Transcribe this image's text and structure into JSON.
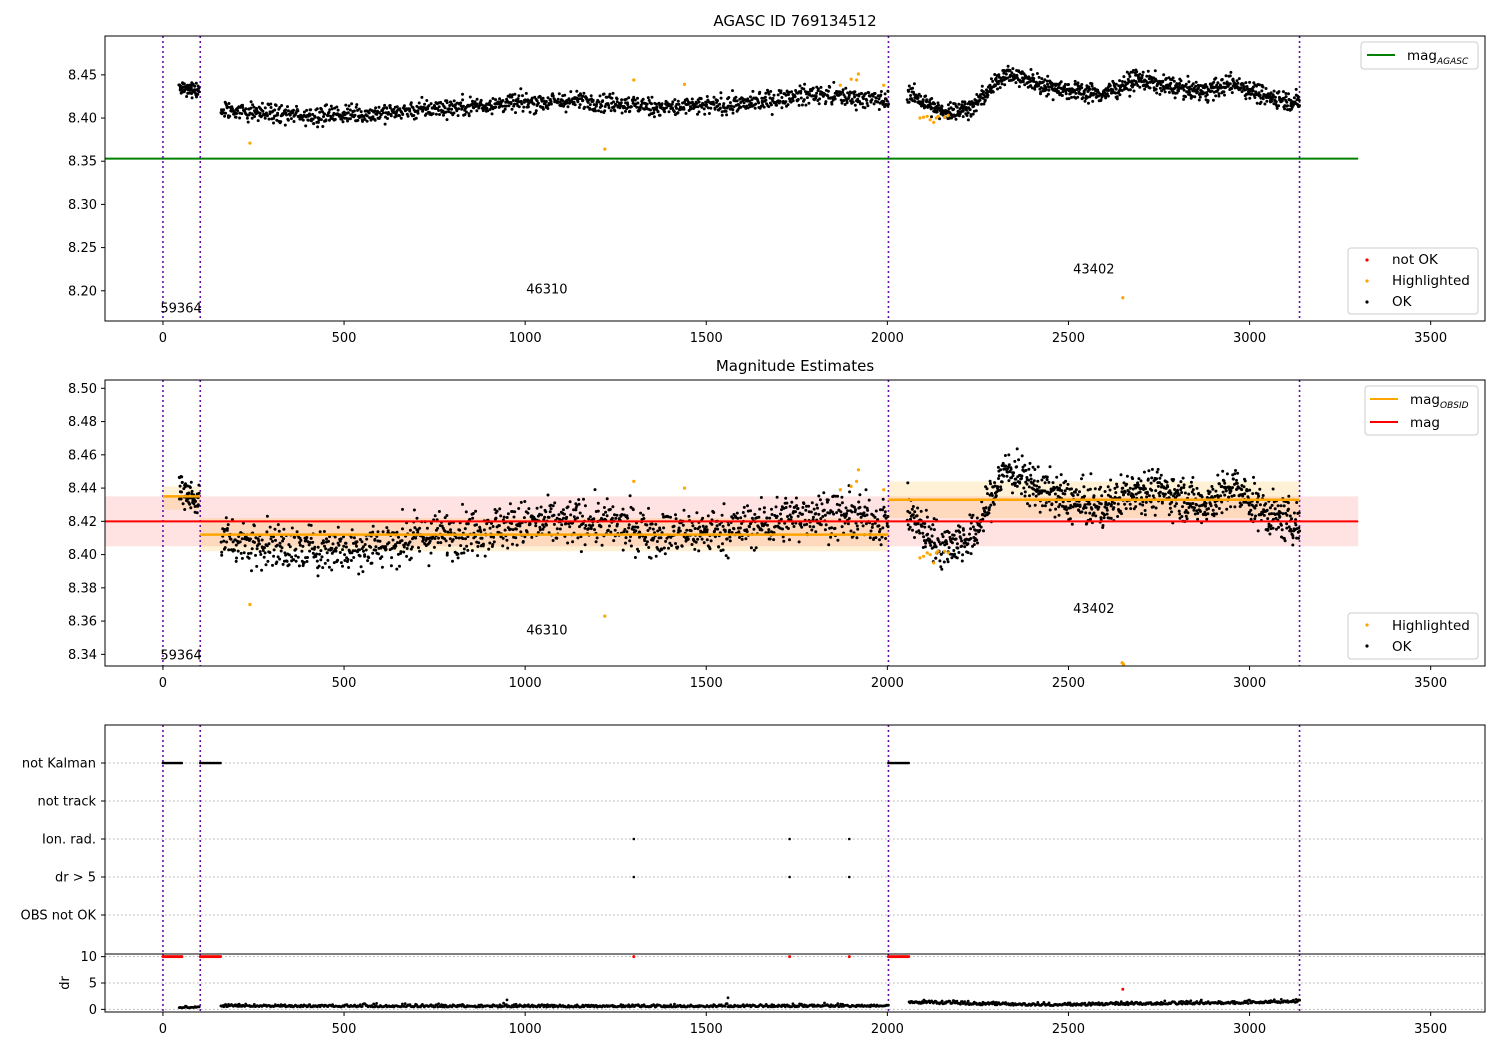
{
  "chart_data": [
    {
      "type": "scatter",
      "title": "AGASC ID 769134512",
      "xlim": [
        -160,
        3650
      ],
      "ylim": [
        8.165,
        8.495
      ],
      "x_ticks": [
        0,
        500,
        1000,
        1500,
        2000,
        2500,
        3000,
        3500
      ],
      "y_ticks": [
        8.2,
        8.25,
        8.3,
        8.35,
        8.4,
        8.45
      ],
      "grid": false,
      "legend_upper": {
        "placement": "top-right",
        "entries": [
          {
            "label": "mag",
            "sub": "AGASC",
            "color": "#008000"
          }
        ]
      },
      "legend_lower": {
        "placement": "bottom-right",
        "entries": [
          {
            "label": "not OK",
            "color": "#ff0000"
          },
          {
            "label": "Highlighted",
            "color": "#ffa500"
          },
          {
            "label": "OK",
            "color": "#000000"
          }
        ]
      },
      "reference_line": {
        "name": "mag_AGASC",
        "y": 8.353,
        "x": [
          -160,
          3300
        ],
        "color": "#008000"
      },
      "obsid_boundaries": [
        0,
        103,
        2003,
        3138
      ],
      "obsid_labels": [
        {
          "text": "59364",
          "x": 50,
          "y": 8.175
        },
        {
          "text": "46310",
          "x": 1060,
          "y": 8.197
        },
        {
          "text": "43402",
          "x": 2570,
          "y": 8.22
        }
      ],
      "series": [
        {
          "name": "OK",
          "color": "#000000",
          "segments": [
            {
              "x0": 45,
              "x1": 100,
              "n": 60,
              "level": [
                8.437,
                8.43
              ],
              "noise": 0.0045
            },
            {
              "x0": 160,
              "x1": 2003,
              "n": 1300,
              "level": [
                8.41,
                8.403,
                8.405,
                8.412,
                8.418,
                8.42,
                8.412,
                8.416,
                8.428,
                8.42
              ],
              "noise": 0.0055
            },
            {
              "x0": 2055,
              "x1": 3138,
              "n": 1000,
              "level": [
                8.43,
                8.407,
                8.412,
                8.452,
                8.44,
                8.432,
                8.428,
                8.445,
                8.437,
                8.43,
                8.44,
                8.425,
                8.418
              ],
              "noise": 0.0055
            }
          ]
        },
        {
          "name": "Highlighted",
          "color": "#ffa500",
          "points": [
            [
              240,
              8.371
            ],
            [
              1220,
              8.364
            ],
            [
              1300,
              8.444
            ],
            [
              1440,
              8.439
            ],
            [
              1870,
              8.438
            ],
            [
              1900,
              8.445
            ],
            [
              1915,
              8.444
            ],
            [
              1920,
              8.451
            ],
            [
              1990,
              8.438
            ],
            [
              2090,
              8.4
            ],
            [
              2100,
              8.401
            ],
            [
              2110,
              8.402
            ],
            [
              2118,
              8.398
            ],
            [
              2128,
              8.395
            ],
            [
              2135,
              8.4
            ],
            [
              2140,
              8.402
            ],
            [
              2158,
              8.401
            ],
            [
              2168,
              8.403
            ],
            [
              2650,
              8.192
            ]
          ]
        },
        {
          "name": "not OK",
          "color": "#ff0000",
          "points": []
        }
      ]
    },
    {
      "type": "scatter",
      "title": "Magnitude Estimates",
      "xlim": [
        -160,
        3650
      ],
      "ylim": [
        8.333,
        8.505
      ],
      "x_ticks": [
        0,
        500,
        1000,
        1500,
        2000,
        2500,
        3000,
        3500
      ],
      "y_ticks": [
        8.34,
        8.36,
        8.38,
        8.4,
        8.42,
        8.44,
        8.46,
        8.48,
        8.5
      ],
      "grid": false,
      "legend_upper": {
        "placement": "top-right",
        "entries": [
          {
            "label": "mag",
            "sub": "OBSID",
            "color": "#ffa500"
          },
          {
            "label": "mag",
            "sub": "",
            "color": "#ff0000"
          }
        ]
      },
      "legend_lower": {
        "placement": "bottom-right",
        "entries": [
          {
            "label": "Highlighted",
            "color": "#ffa500"
          },
          {
            "label": "OK",
            "color": "#000000"
          }
        ]
      },
      "mag": {
        "value": 8.42,
        "band": [
          8.405,
          8.435
        ],
        "x": [
          -160,
          3300
        ]
      },
      "mag_obsid": [
        {
          "x0": 0,
          "x1": 103,
          "y": 8.435,
          "band": [
            8.427,
            8.441
          ]
        },
        {
          "x0": 103,
          "x1": 2003,
          "y": 8.412,
          "band": [
            8.402,
            8.422
          ]
        },
        {
          "x0": 2003,
          "x1": 3138,
          "y": 8.433,
          "band": [
            8.422,
            8.444
          ]
        }
      ],
      "obsid_boundaries": [
        0,
        103,
        2003,
        3138
      ],
      "obsid_labels": [
        {
          "text": "59364",
          "x": 50,
          "y": 8.337
        },
        {
          "text": "46310",
          "x": 1060,
          "y": 8.352
        },
        {
          "text": "43402",
          "x": 2570,
          "y": 8.365
        }
      ],
      "series": [
        {
          "name": "OK",
          "color": "#000000",
          "segments": [
            {
              "x0": 45,
              "x1": 100,
              "n": 60,
              "level": [
                8.44,
                8.432
              ],
              "noise": 0.005
            },
            {
              "x0": 160,
              "x1": 2003,
              "n": 1300,
              "level": [
                8.41,
                8.403,
                8.405,
                8.412,
                8.418,
                8.42,
                8.412,
                8.416,
                8.425,
                8.42
              ],
              "noise": 0.007
            },
            {
              "x0": 2055,
              "x1": 3138,
              "n": 1000,
              "level": [
                8.425,
                8.405,
                8.41,
                8.452,
                8.44,
                8.432,
                8.428,
                8.44,
                8.437,
                8.43,
                8.44,
                8.425,
                8.418
              ],
              "noise": 0.0065
            }
          ]
        },
        {
          "name": "Highlighted",
          "color": "#ffa500",
          "points": [
            [
              240,
              8.37
            ],
            [
              1220,
              8.363
            ],
            [
              1300,
              8.444
            ],
            [
              1440,
              8.44
            ],
            [
              1870,
              8.439
            ],
            [
              1900,
              8.441
            ],
            [
              1915,
              8.444
            ],
            [
              1920,
              8.451
            ],
            [
              1990,
              8.439
            ],
            [
              2090,
              8.398
            ],
            [
              2100,
              8.399
            ],
            [
              2110,
              8.401
            ],
            [
              2118,
              8.4
            ],
            [
              2128,
              8.395
            ],
            [
              2135,
              8.401
            ],
            [
              2140,
              8.402
            ],
            [
              2158,
              8.402
            ],
            [
              2168,
              8.401
            ],
            [
              2648,
              8.335
            ],
            [
              2652,
              8.334
            ]
          ]
        }
      ]
    },
    {
      "type": "scatter",
      "title": "",
      "xlim": [
        -160,
        3650
      ],
      "categories": [
        "not Kalman",
        "not track",
        "Ion. rad.",
        "dr > 5",
        "OBS not OK"
      ],
      "obsid_boundaries": [
        0,
        103,
        2003,
        3138
      ],
      "flags": [
        {
          "category": "not Kalman",
          "runs": [
            [
              0,
              55
            ],
            [
              103,
              160
            ],
            [
              2003,
              2060
            ]
          ],
          "points": []
        },
        {
          "category": "not track",
          "runs": [],
          "points": []
        },
        {
          "category": "Ion. rad.",
          "runs": [],
          "points": [
            1300,
            1730,
            1895
          ]
        },
        {
          "category": "dr > 5",
          "runs": [],
          "points": [
            1300,
            1730,
            1895
          ]
        },
        {
          "category": "OBS not OK",
          "runs": [],
          "points": []
        }
      ]
    },
    {
      "type": "scatter",
      "ylabel": "dr",
      "xlim": [
        -160,
        3650
      ],
      "ylim": [
        -0.5,
        10.5
      ],
      "x_ticks": [
        0,
        500,
        1000,
        1500,
        2000,
        2500,
        3000,
        3500
      ],
      "y_ticks": [
        0,
        5,
        10
      ],
      "grid": true,
      "obsid_boundaries": [
        0,
        103,
        2003,
        3138
      ],
      "clipped_at_10": {
        "color": "#ff0000",
        "runs": [
          [
            0,
            55
          ],
          [
            103,
            160
          ],
          [
            2003,
            2060
          ]
        ],
        "points": [
          1300,
          1730,
          1895
        ]
      },
      "series": [
        {
          "name": "dr",
          "color": "#000000",
          "segments": [
            {
              "x0": 45,
              "x1": 100,
              "n": 20,
              "level": [
                0.3
              ],
              "noise": 0.15
            },
            {
              "x0": 160,
              "x1": 2003,
              "n": 700,
              "level": [
                0.5,
                0.4,
                0.5
              ],
              "noise": 0.25
            },
            {
              "x0": 2060,
              "x1": 3138,
              "n": 450,
              "level": [
                1.2,
                0.8,
                0.7,
                0.9,
                1.0,
                1.3
              ],
              "noise": 0.3
            }
          ]
        },
        {
          "name": "dr outliers",
          "color": "#000000",
          "points": [
            [
              950,
              1.8
            ],
            [
              1560,
              2.2
            ]
          ]
        },
        {
          "name": "dr red",
          "color": "#ff0000",
          "points": [
            [
              2650,
              3.8
            ]
          ]
        }
      ]
    }
  ]
}
